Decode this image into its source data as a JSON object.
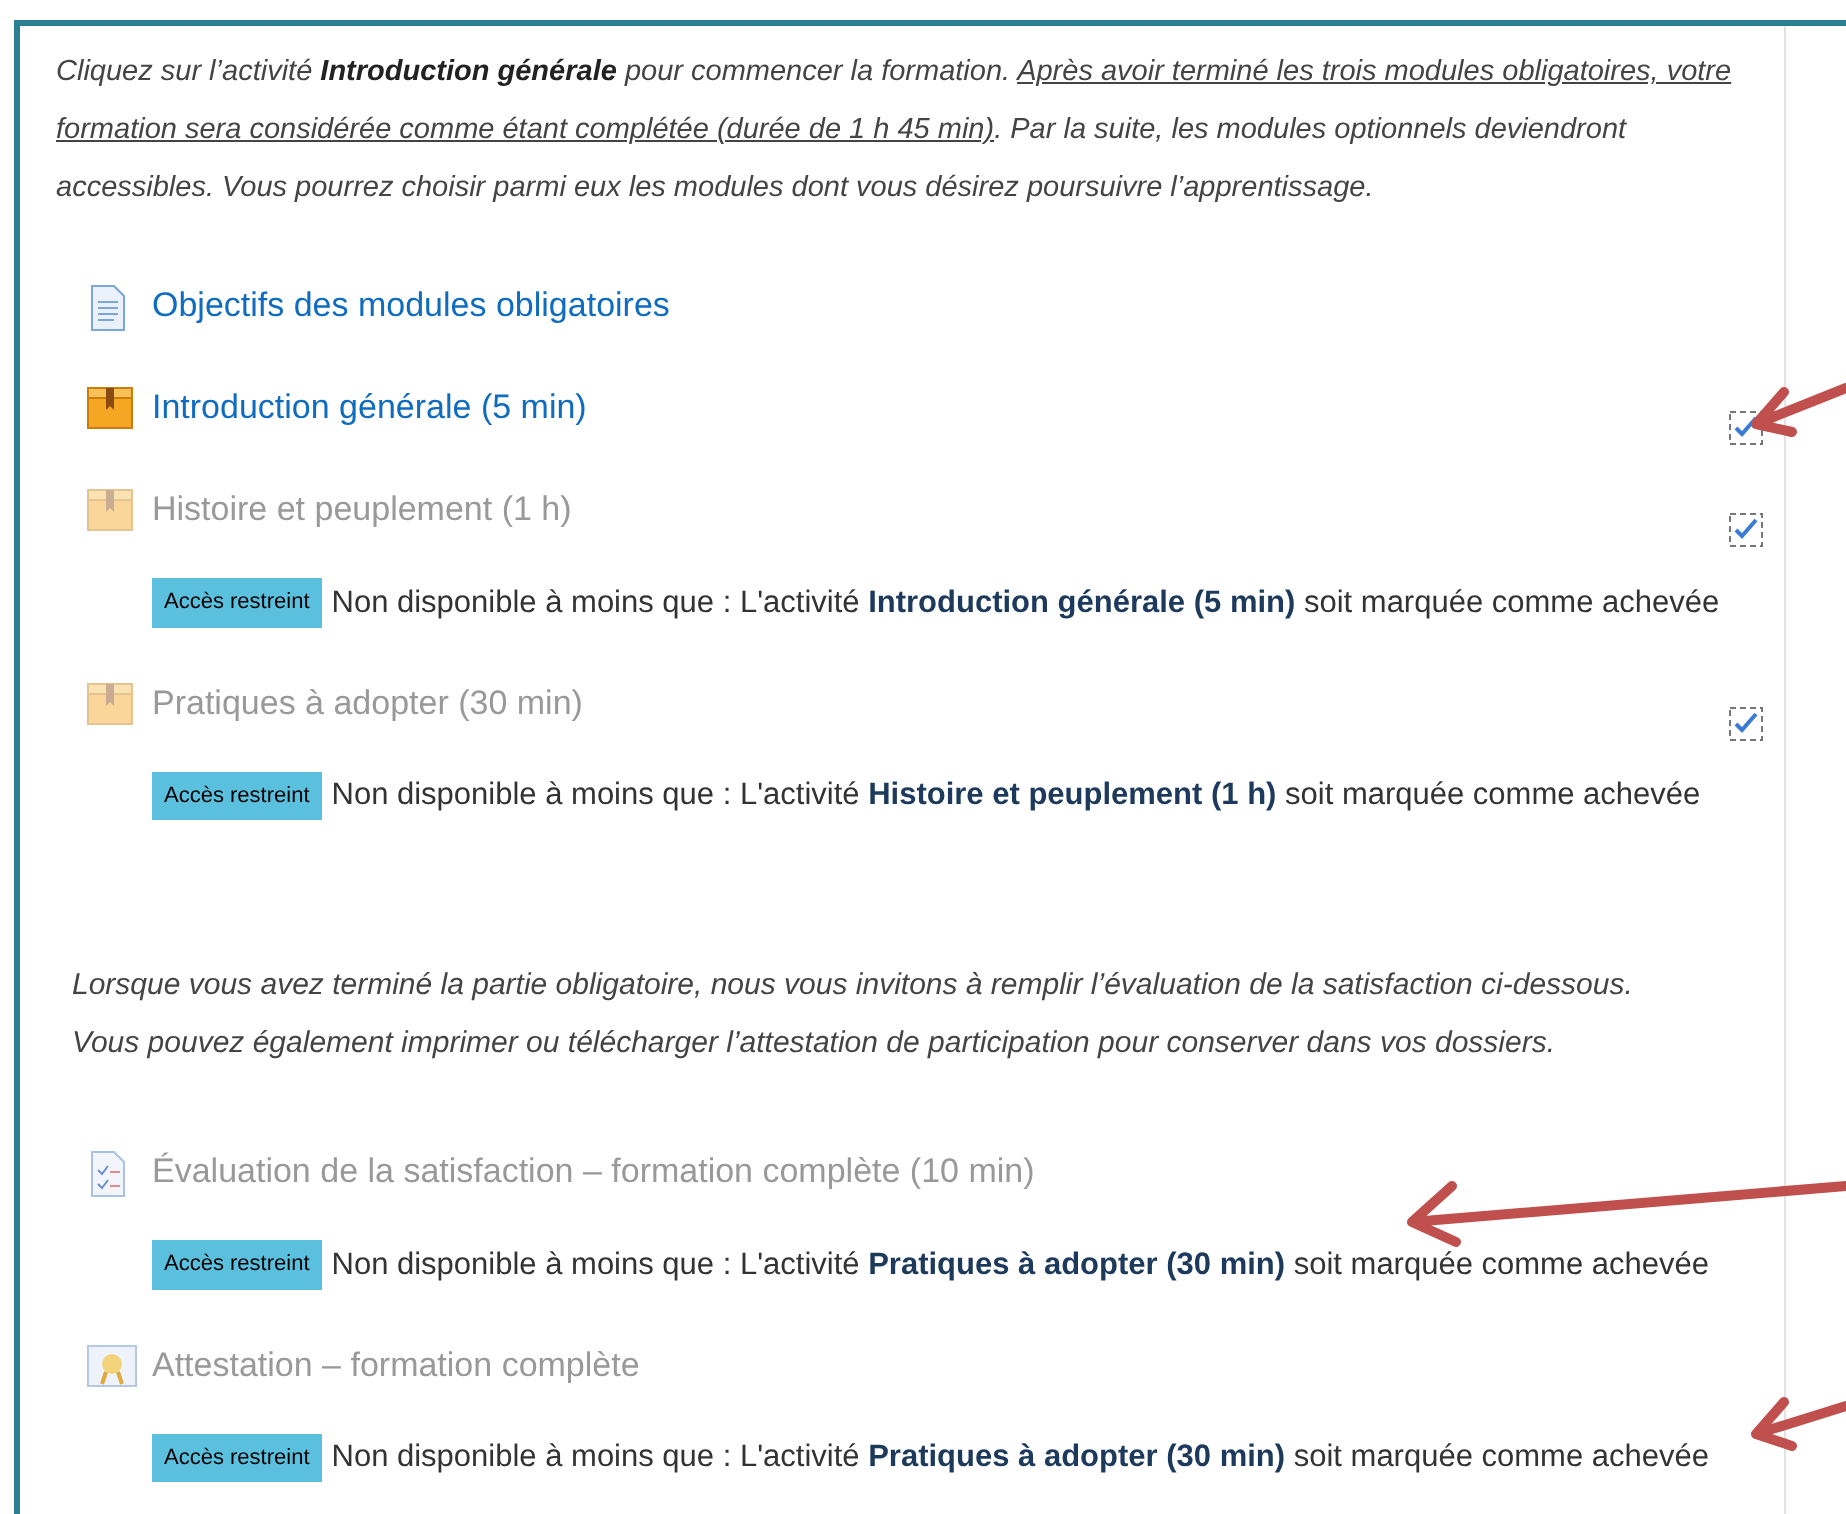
{
  "intro": {
    "before": "Cliquez sur l’activité **Introduction générale** pour commencer la formation. ",
    "underlined": "Après avoir terminé les trois modules obligatoires, votre formation sera considérée comme étant complétée (durée de 1 h 45 min)",
    "after": ". Par la suite, les modules optionnels deviendront accessibles. Vous pourrez choisir parmi eux les modules dont vous désirez poursuivre l’apprentissage."
  },
  "mandatory": [
    {
      "kind": "page",
      "title": "Objectifs des modules obligatoires",
      "available": true,
      "completion_box": false
    },
    {
      "kind": "lesson",
      "title": "Introduction générale (5 min)",
      "available": true,
      "completion_box": true
    },
    {
      "kind": "lesson",
      "title": "Histoire et peuplement (1 h)",
      "available": false,
      "completion_box": true,
      "badge": "Accès restreint",
      "restriction": "Non disponible à moins que : L'activité **Introduction générale (5 min)** soit marquée comme achevée"
    },
    {
      "kind": "lesson",
      "title": "Pratiques à adopter (30 min)",
      "available": false,
      "completion_box": true,
      "badge": "Accès restreint",
      "restriction": "Non disponible à moins que : L'activité **Histoire et peuplement (1 h)** soit marquée comme achevée"
    }
  ],
  "note": [
    "Lorsque vous avez terminé la partie obligatoire, nous vous invitons à remplir l’évaluation de la satisfaction ci-dessous.",
    "Vous pouvez également imprimer ou télécharger l’attestation de participation pour conserver dans vos dossiers."
  ],
  "final": [
    {
      "kind": "feedback",
      "title": "Évaluation de la satisfaction – formation complète (10 min)",
      "available": false,
      "completion_box": false,
      "badge": "Accès restreint",
      "restriction": "Non disponible à moins que : L'activité **Pratiques à adopter (30 min)** soit marquée comme achevée"
    },
    {
      "kind": "certificate",
      "title": "Attestation – formation complète",
      "available": false,
      "completion_box": false,
      "badge": "Accès restreint",
      "restriction": "Non disponible à moins que : L'activité **Pratiques à adopter (30 min)** soit marquée comme achevée"
    }
  ]
}
